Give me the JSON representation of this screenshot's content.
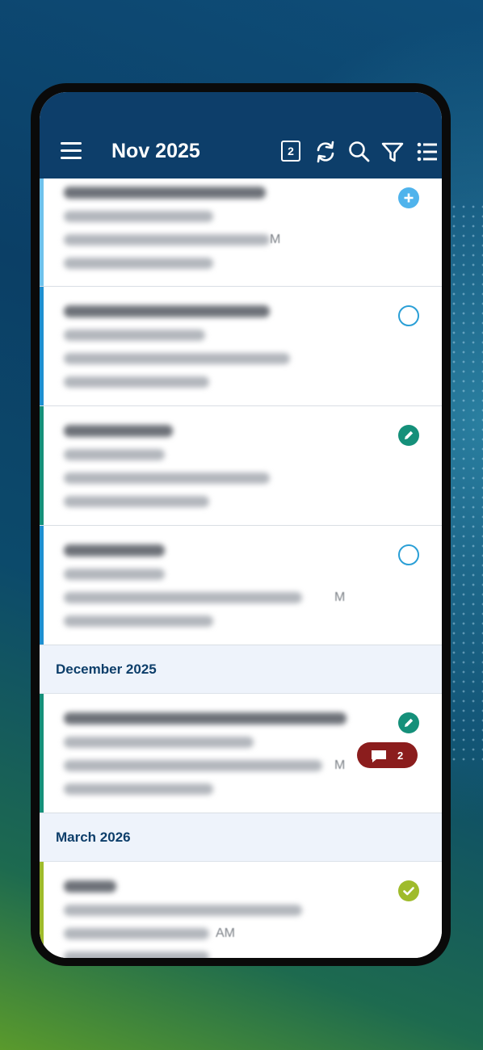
{
  "header": {
    "title": "Nov 2025",
    "calendar_day": "2"
  },
  "colors": {
    "appbar": "#0d3e6a",
    "blue": "#2a9fd6",
    "teal": "#15907a",
    "lime": "#9fbb2b",
    "comment_red": "#8b1d1d"
  },
  "items": [
    {
      "status_icon": "plus-circle-icon",
      "bar_color": "#6fc2ec",
      "time_suffix": "M"
    },
    {
      "status_icon": "empty-circle-icon",
      "bar_color": "#1e8fd0",
      "time_suffix": ""
    },
    {
      "status_icon": "pencil-circle-icon",
      "bar_color": "#15907a",
      "time_suffix": ""
    },
    {
      "status_icon": "empty-circle-icon",
      "bar_color": "#1e8fd0",
      "time_suffix": "M"
    }
  ],
  "sections": {
    "december": "December 2025",
    "march": "March 2026"
  },
  "december_items": [
    {
      "status_icon": "pencil-circle-icon",
      "bar_color": "#15907a",
      "comment_count": "2",
      "time_suffix": "M"
    }
  ],
  "march_items": [
    {
      "status_icon": "check-circle-icon",
      "bar_color": "#9fbb2b",
      "time_suffix": "AM"
    }
  ]
}
